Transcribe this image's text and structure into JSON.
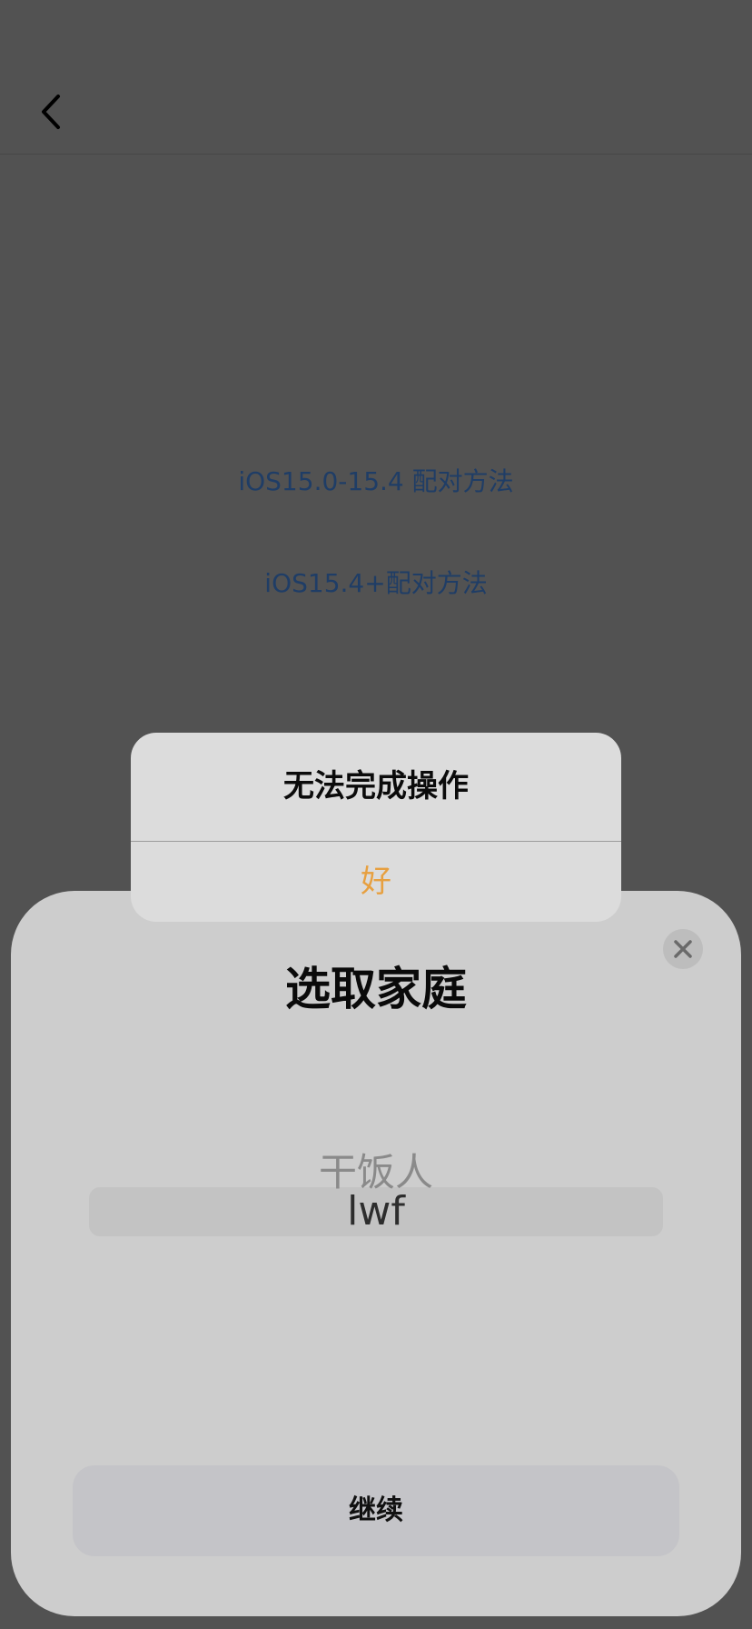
{
  "links": {
    "pair_15_0_15_4": "iOS15.0-15.4 配对方法",
    "pair_15_4_plus": "iOS15.4+配对方法"
  },
  "sheet": {
    "title": "选取家庭",
    "picker_options": [
      "干饭人",
      "lwf"
    ],
    "selected_index": 1,
    "continue_label": "继续"
  },
  "alert": {
    "title": "无法完成操作",
    "ok_label": "好",
    "ok_color": "#e7a040"
  },
  "icons": {
    "back": "chevron-left-icon",
    "close": "close-icon"
  }
}
